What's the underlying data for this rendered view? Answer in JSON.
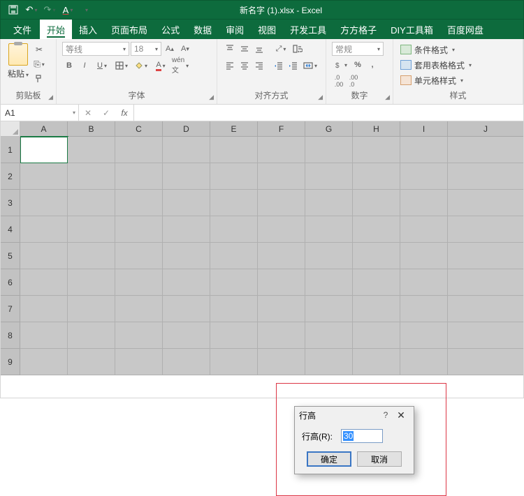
{
  "titlebar": {
    "title": "新名字 (1).xlsx - Excel"
  },
  "tabs": {
    "file": "文件",
    "home": "开始",
    "insert": "插入",
    "pagelayout": "页面布局",
    "formulas": "公式",
    "data": "数据",
    "review": "审阅",
    "view": "视图",
    "developer": "开发工具",
    "fangfang": "方方格子",
    "diy": "DIY工具箱",
    "baidu": "百度网盘"
  },
  "ribbon": {
    "clipboard": {
      "paste": "粘贴",
      "label": "剪贴板"
    },
    "font": {
      "name": "等线",
      "size": "18",
      "label": "字体"
    },
    "alignment": {
      "label": "对齐方式"
    },
    "number": {
      "format": "常规",
      "label": "数字"
    },
    "styles": {
      "cond": "条件格式",
      "table": "套用表格格式",
      "cell": "单元格样式",
      "label": "样式"
    }
  },
  "fbar": {
    "ref": "A1"
  },
  "grid": {
    "cols": [
      "A",
      "B",
      "C",
      "D",
      "E",
      "F",
      "G",
      "H",
      "I",
      "J"
    ],
    "rows": [
      "1",
      "2",
      "3",
      "4",
      "5",
      "6",
      "7",
      "8",
      "9"
    ]
  },
  "dialog": {
    "title": "行高",
    "label": "行高(R):",
    "value": "30",
    "ok": "确定",
    "cancel": "取消"
  }
}
